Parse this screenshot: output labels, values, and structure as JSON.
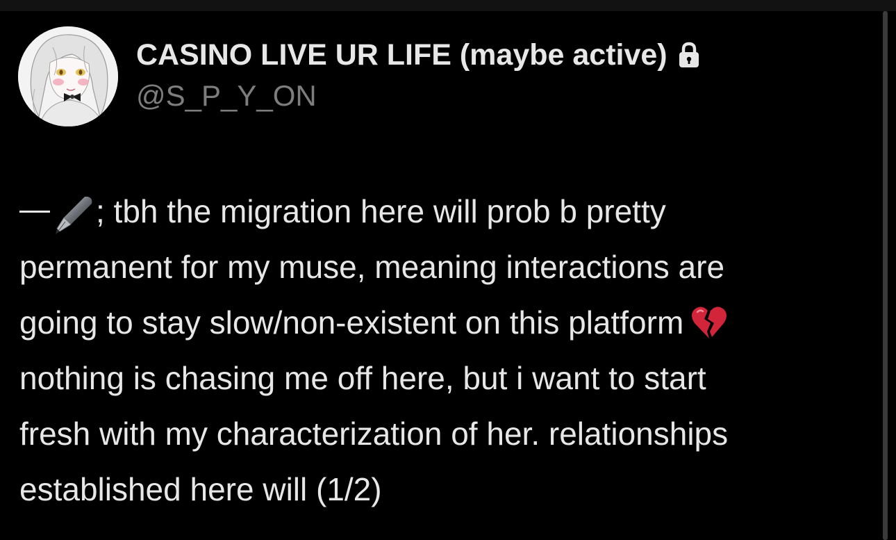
{
  "profile": {
    "display_name": "CASINO LIVE UR LIFE (maybe active)",
    "handle": "@S_P_Y_ON",
    "protected_icon": "lock-icon",
    "avatar_icon": "anime-avatar"
  },
  "tweet": {
    "prefix_icons": [
      "em-dash",
      "fountain-pen-emoji"
    ],
    "line1": "; tbh the migration here will prob b pretty",
    "line2": "permanent for my muse, meaning interactions are",
    "line3": "going to stay slow/non-existent on this platform",
    "line3_emoji": "broken-heart-emoji",
    "line4": "nothing is chasing me off here, but i want to start",
    "line5": "fresh with my characterization of her. relationships",
    "line6": "established here will (1/2)"
  },
  "colors": {
    "background": "#000000",
    "primary_text": "#e7e7e7",
    "secondary_text": "#7d7d7d",
    "heart_red": "#d2253a"
  }
}
